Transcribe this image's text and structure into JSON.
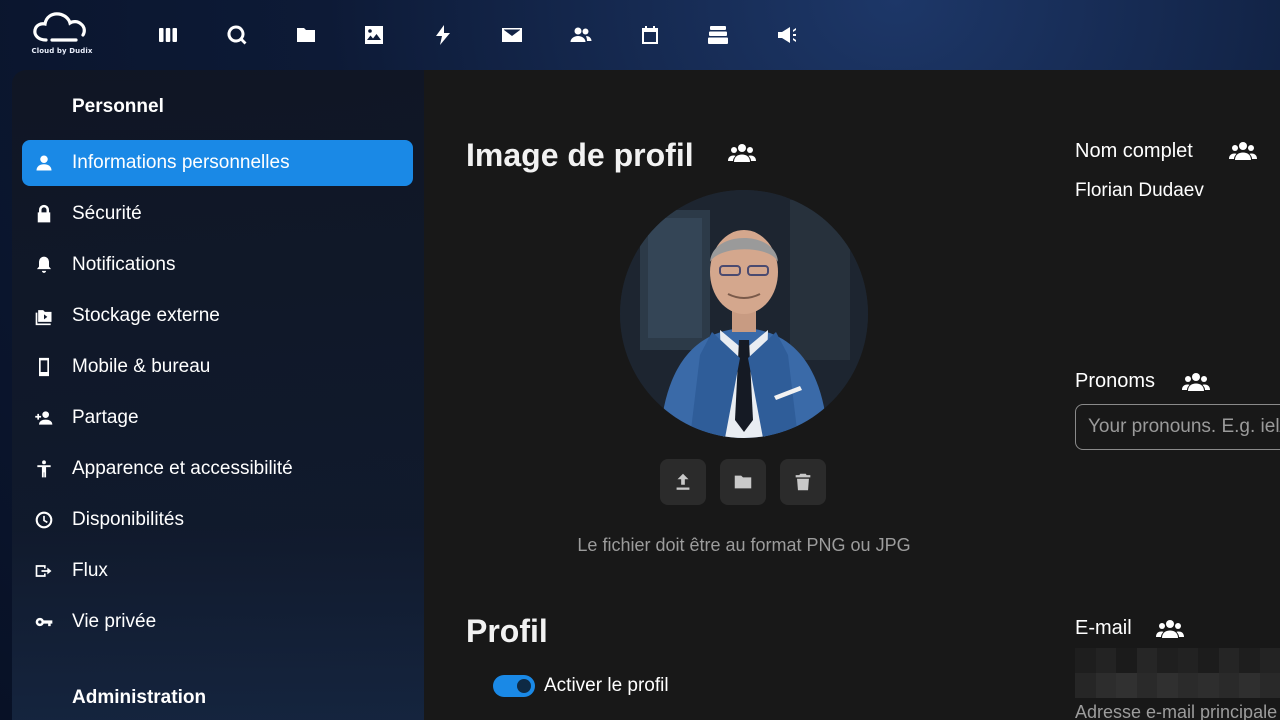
{
  "header": {
    "logo_text": "Cloud by Dudix",
    "apps": [
      {
        "name": "dashboard-icon"
      },
      {
        "name": "search-icon"
      },
      {
        "name": "files-icon"
      },
      {
        "name": "photos-icon"
      },
      {
        "name": "activity-icon"
      },
      {
        "name": "mail-icon"
      },
      {
        "name": "contacts-icon"
      },
      {
        "name": "calendar-icon"
      },
      {
        "name": "deck-icon"
      },
      {
        "name": "announcements-icon"
      }
    ]
  },
  "sidebar": {
    "personal_title": "Personnel",
    "items": [
      {
        "label": "Informations personnelles",
        "icon": "person-icon",
        "active": true
      },
      {
        "label": "Sécurité",
        "icon": "lock-icon"
      },
      {
        "label": "Notifications",
        "icon": "bell-icon"
      },
      {
        "label": "Stockage externe",
        "icon": "external-storage-icon"
      },
      {
        "label": "Mobile & bureau",
        "icon": "phone-icon"
      },
      {
        "label": "Partage",
        "icon": "share-user-icon"
      },
      {
        "label": "Apparence et accessibilité",
        "icon": "accessibility-icon"
      },
      {
        "label": "Disponibilités",
        "icon": "clock-icon"
      },
      {
        "label": "Flux",
        "icon": "flow-icon"
      },
      {
        "label": "Vie privée",
        "icon": "key-icon"
      }
    ],
    "admin_title": "Administration"
  },
  "main": {
    "profile_picture_title": "Image de profil",
    "file_hint": "Le fichier doit être au format PNG ou JPG",
    "profile_title": "Profil",
    "enable_profile_label": "Activer le profil",
    "enable_profile_on": true
  },
  "fields": {
    "full_name_label": "Nom complet",
    "full_name_value": "Florian Dudaev",
    "pronouns_label": "Pronoms",
    "pronouns_placeholder": "Your pronouns. E.g. iel/",
    "email_label": "E-mail",
    "email_helper": "Adresse e-mail principale"
  },
  "colors": {
    "accent": "#1a89e6",
    "content_bg": "#181818",
    "header_bg": "#0d1a36"
  }
}
